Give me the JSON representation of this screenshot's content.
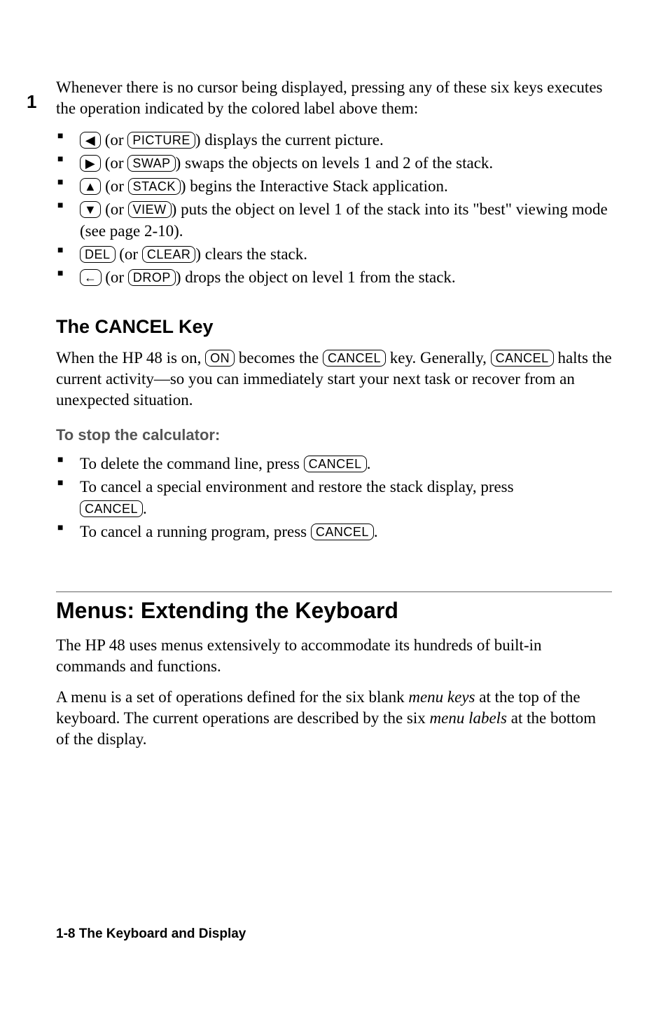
{
  "chapterNumber": "1",
  "intro": "Whenever there is no cursor being displayed, pressing any of these six keys executes the operation indicated by the colored label above them:",
  "bullets1": [
    {
      "key1": "◀",
      "key2": "PICTURE",
      "rest": ") displays the current picture."
    },
    {
      "key1": "▶",
      "key2": "SWAP",
      "rest": ") swaps the objects on levels 1 and 2 of the stack."
    },
    {
      "key1": "▲",
      "key2": "STACK",
      "rest": ") begins the Interactive Stack application."
    },
    {
      "key1": "▼",
      "key2": "VIEW",
      "rest": ") puts the object on level 1 of the stack into its \"best\" viewing mode (see page 2-10)."
    },
    {
      "key1": "DEL",
      "key2": "CLEAR",
      "rest": ") clears the stack.",
      "noarrow": true
    },
    {
      "key1": "←",
      "key2": "DROP",
      "rest": ") drops the object on level 1 from the stack."
    }
  ],
  "subhead1": "The CANCEL Key",
  "cancel_para_parts": {
    "p1a": "When the HP 48 is on, ",
    "on": "ON",
    "p1b": " becomes the ",
    "cancel": "CANCEL",
    "p1c": " key. Generally, ",
    "p1d": " halts the current activity—so you can immediately start your next task or recover from an unexpected situation."
  },
  "proc_head": "To stop the calculator:",
  "bullets2": [
    {
      "pre": "To delete the command line, press ",
      "key": "CANCEL",
      "post": "."
    },
    {
      "pre": "To cancel a special environment and restore the stack display, press ",
      "key": "CANCEL",
      "post": ".",
      "wrap": true
    },
    {
      "pre": "To cancel a running program, press ",
      "key": "CANCEL",
      "post": "."
    }
  ],
  "section2": "Menus: Extending the Keyboard",
  "para2": "The HP 48 uses menus extensively to accommodate its hundreds of built-in commands and functions.",
  "para3_parts": {
    "a": "A menu is a set of operations defined for the six blank ",
    "i1": "menu keys",
    "b": " at the top of the keyboard. The current operations are described by the six ",
    "i2": "menu labels",
    "c": " at the bottom of the display."
  },
  "footer": "1-8   The Keyboard and Display"
}
